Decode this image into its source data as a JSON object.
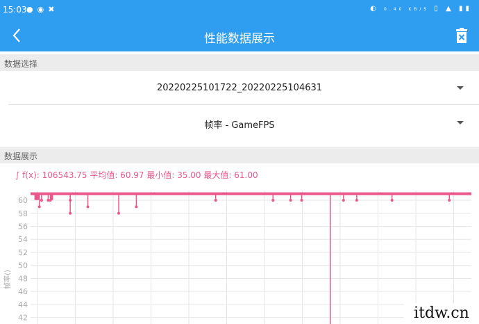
{
  "status_bar": {
    "time": "15:03",
    "left_icons": [
      "bulb-icon",
      "shield-icon",
      "tools-icon"
    ],
    "right_icons": [
      "hotspot-icon",
      "data-speed-icon",
      "sim-icon",
      "wifi-icon",
      "battery-icon"
    ],
    "data_speed": "0.40 KB/S"
  },
  "app_bar": {
    "title": "性能数据展示",
    "back_icon": "chevron-left-icon",
    "delete_icon": "trash-icon",
    "color": "#2f9df0"
  },
  "data_select": {
    "header": "数据选择",
    "session_value": "20220225101722_20220225104631",
    "metric_value": "帧率 - GameFPS"
  },
  "data_display": {
    "header": "数据展示",
    "stats_line": "∫ f(x): 106543.75 平均值: 60.97 最小值: 35.00 最大值: 61.00"
  },
  "chart_data": {
    "type": "line",
    "series": [
      {
        "color": "#e8588c",
        "baseline": 61,
        "dips": [
          {
            "x": 0.02,
            "y": 59
          },
          {
            "x": 0.025,
            "y": 60
          },
          {
            "x": 0.04,
            "y": 60
          },
          {
            "x": 0.045,
            "y": 60
          },
          {
            "x": 0.09,
            "y": 58
          },
          {
            "x": 0.09,
            "y": 60
          },
          {
            "x": 0.13,
            "y": 59
          },
          {
            "x": 0.2,
            "y": 58
          },
          {
            "x": 0.24,
            "y": 59
          },
          {
            "x": 0.42,
            "y": 60
          },
          {
            "x": 0.55,
            "y": 60
          },
          {
            "x": 0.59,
            "y": 60
          },
          {
            "x": 0.615,
            "y": 60
          },
          {
            "x": 0.68,
            "y": 35
          },
          {
            "x": 0.71,
            "y": 60
          },
          {
            "x": 0.74,
            "y": 60
          },
          {
            "x": 0.82,
            "y": 60
          },
          {
            "x": 0.95,
            "y": 60
          }
        ]
      }
    ],
    "y_ticks": [
      "60",
      "58",
      "56",
      "54",
      "52",
      "50",
      "48",
      "46",
      "44",
      "42"
    ],
    "ylim": [
      41,
      61.5
    ],
    "ylabel": "帧率()",
    "grid": true,
    "grid_color": "#e6e6e6"
  },
  "watermark": "itdw.cn"
}
